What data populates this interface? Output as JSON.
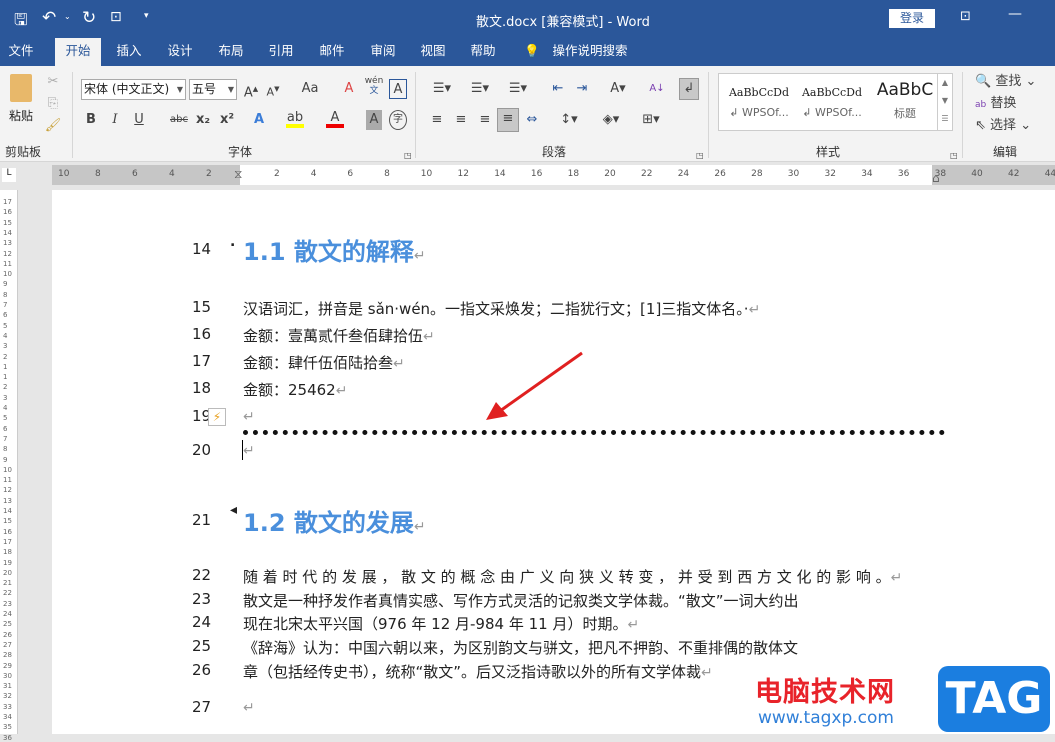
{
  "title": {
    "doc": "散文.docx [兼容模式]  -  Word",
    "login": "登录"
  },
  "tabs": [
    "文件",
    "开始",
    "插入",
    "设计",
    "布局",
    "引用",
    "邮件",
    "审阅",
    "视图",
    "帮助",
    "操作说明搜索"
  ],
  "ribbon": {
    "clipboard": {
      "paste": "粘贴",
      "label": "剪贴板"
    },
    "font": {
      "name": "宋体 (中文正文)",
      "size": "五号",
      "label": "字体",
      "case": "Aa",
      "pinyin_top": "wén",
      "pinyin_bottom": "文",
      "border_char": "A",
      "enclose": "字",
      "bold": "B",
      "italic": "I",
      "underline": "U",
      "strike": "abc",
      "sub": "x₂",
      "sup": "x²"
    },
    "paragraph": {
      "label": "段落"
    },
    "styles": {
      "label": "样式",
      "items": [
        {
          "preview": "AaBbCcDd",
          "name": "↲ WPSOf..."
        },
        {
          "preview": "AaBbCcDd",
          "name": "↲ WPSOf..."
        },
        {
          "preview": "AaBbC",
          "name": "标题"
        }
      ]
    },
    "editing": {
      "label": "编辑",
      "find": "查找",
      "replace": "替换",
      "select": "选择"
    }
  },
  "ruler": {
    "left": [
      "10",
      "8",
      "6",
      "4",
      "2"
    ],
    "right": [
      "2",
      "4",
      "6",
      "8",
      "10",
      "12",
      "14",
      "16",
      "18",
      "20",
      "22",
      "24",
      "26",
      "28",
      "30",
      "32",
      "34",
      "36",
      "38",
      "40",
      "42",
      "44"
    ]
  },
  "vruler": [
    "17",
    "16",
    "15",
    "14",
    "13",
    "12",
    "11",
    "10",
    "9",
    "8",
    "7",
    "6",
    "5",
    "4",
    "3",
    "2",
    "1",
    "1",
    "2",
    "3",
    "4",
    "5",
    "6",
    "7",
    "8",
    "9",
    "10",
    "11",
    "12",
    "13",
    "14",
    "15",
    "16",
    "17",
    "18",
    "19",
    "20",
    "21",
    "22",
    "23",
    "24",
    "25",
    "26",
    "27",
    "28",
    "29",
    "30",
    "31",
    "32",
    "33",
    "34",
    "35",
    "36"
  ],
  "document": {
    "lines": [
      {
        "n": "14",
        "text": "1.1 散文的解释",
        "heading": true
      },
      {
        "n": "15",
        "text": "汉语词汇，拼音是 sǎn·wén。一指文采焕发；二指犹行文；[1]三指文体名。·"
      },
      {
        "n": "16",
        "text": "金额：壹萬贰仟叁佰肆拾伍"
      },
      {
        "n": "17",
        "text": "金额：肆仟伍佰陆拾叁"
      },
      {
        "n": "18",
        "text": "金额：25462"
      },
      {
        "n": "19",
        "text": ""
      },
      {
        "n": "20",
        "text": ""
      },
      {
        "n": "21",
        "text": "1.2 散文的发展",
        "heading": true
      },
      {
        "n": "22",
        "text": "随 着 时 代 的 发 展 ， 散 文 的 概 念 由 广 义 向 狭 义 转 变 ， 并 受 到 西 方 文 化 的 影 响 。"
      },
      {
        "n": "23",
        "text": "散文是一种抒发作者真情实感、写作方式灵活的记叙类文学体裁。“散文”一词大约出"
      },
      {
        "n": "24",
        "text": "现在北宋太平兴国（976 年 12 月-984 年 11 月）时期。"
      },
      {
        "n": "25",
        "text": "《辞海》认为：中国六朝以来，为区别韵文与骈文，把凡不押韵、不重排偶的散体文"
      },
      {
        "n": "26",
        "text": "章（包括经传史书），统称“散文”。后又泛指诗歌以外的所有文学体裁"
      },
      {
        "n": "27",
        "text": ""
      }
    ],
    "para_mark": "↵"
  },
  "watermark": {
    "site_cn": "电脑技术网",
    "url": "www.tagxp.com",
    "logo": "TAG"
  },
  "colors": {
    "accent": "#2b579a",
    "heading": "#4a8fdc",
    "arrow": "#e02020"
  }
}
